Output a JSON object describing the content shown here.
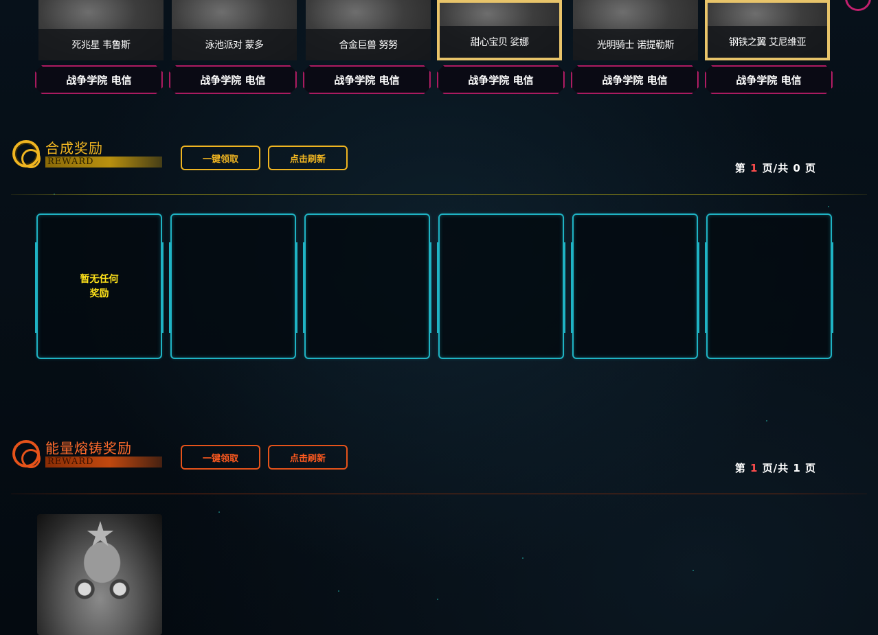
{
  "skins": [
    {
      "name": "死兆星 韦鲁斯",
      "server": "战争学院 电信",
      "selected": false
    },
    {
      "name": "泳池派对 蒙多",
      "server": "战争学院 电信",
      "selected": false
    },
    {
      "name": "合金巨兽 努努",
      "server": "战争学院 电信",
      "selected": false
    },
    {
      "name": "甜心宝贝 娑娜",
      "server": "战争学院 电信",
      "selected": true
    },
    {
      "name": "光明骑士 诺提勒斯",
      "server": "战争学院 电信",
      "selected": false
    },
    {
      "name": "钢铁之翼 艾尼维亚",
      "server": "战争学院 电信",
      "selected": true
    }
  ],
  "synthesis": {
    "title": "合成奖励",
    "subtitle": "REWARD",
    "claim_all": "一键领取",
    "refresh": "点击刷新",
    "pager": {
      "prefix": "第 ",
      "current": "1",
      "middle": " 页/共 ",
      "total": "0",
      "suffix": " 页"
    },
    "empty_line1": "暂无任何",
    "empty_line2": "奖励",
    "accent": "#f0b521",
    "slot_color": "#1fb3c4"
  },
  "forge": {
    "title": "能量熔铸奖励",
    "subtitle": "REWARD",
    "claim_all": "一键领取",
    "refresh": "点击刷新",
    "pager": {
      "prefix": "第 ",
      "current": "1",
      "middle": " 页/共 ",
      "total": "1",
      "suffix": " 页"
    },
    "accent": "#e6531a"
  }
}
